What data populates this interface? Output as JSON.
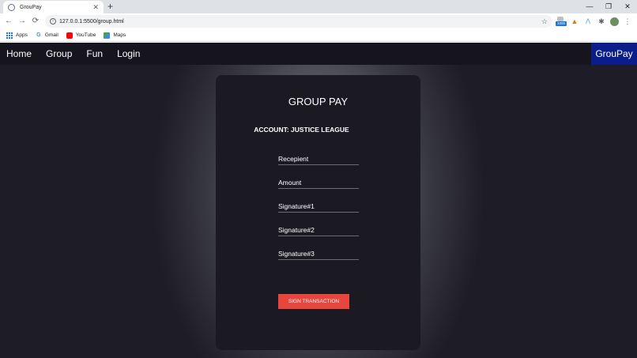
{
  "browser": {
    "tab_title": "GrouPay",
    "tab_close": "✕",
    "new_tab": "+",
    "window_controls": {
      "minimize": "—",
      "restore": "❐",
      "close": "✕"
    },
    "nav": {
      "back": "←",
      "forward": "→",
      "reload": "⟳"
    },
    "url": "127.0.0.1:5500/group.html",
    "bookmark_star": "☆",
    "extensions": {
      "badge_count": "1000"
    },
    "bookmarks": [
      {
        "label": "Apps"
      },
      {
        "label": "Gmail"
      },
      {
        "label": "YouTube"
      },
      {
        "label": "Maps"
      }
    ]
  },
  "nav": {
    "links": [
      "Home",
      "Group",
      "Fun",
      "Login"
    ],
    "brand": "GrouPay"
  },
  "card": {
    "title": "GROUP PAY",
    "account": "ACCOUNT: JUSTICE LEAGUE",
    "fields": [
      {
        "placeholder": "Recepient"
      },
      {
        "placeholder": "Amount"
      },
      {
        "placeholder": "Signature#1"
      },
      {
        "placeholder": "Signature#2"
      },
      {
        "placeholder": "Signature#3"
      }
    ],
    "button": "SIGN TRANSACTION"
  },
  "colors": {
    "accent_button": "#e8453c",
    "brand_bg": "#0b1d8a",
    "nav_bg": "#16151d",
    "card_bg": "#1b1a22"
  }
}
